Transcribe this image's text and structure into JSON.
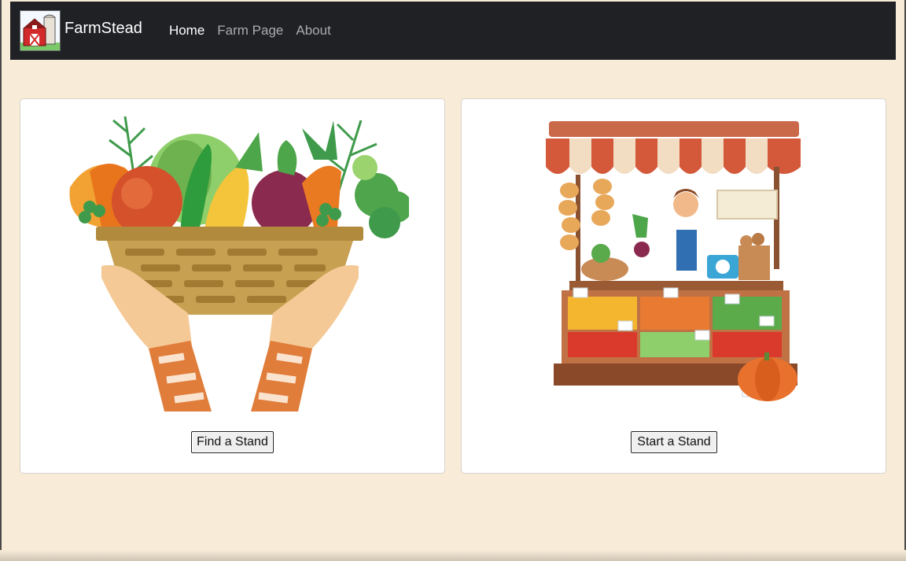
{
  "navbar": {
    "brand": "FarmStead",
    "links": [
      {
        "label": "Home",
        "active": true
      },
      {
        "label": "Farm Page",
        "active": false
      },
      {
        "label": "About",
        "active": false
      }
    ]
  },
  "cards": [
    {
      "button_label": "Find a Stand"
    },
    {
      "button_label": "Start a Stand"
    }
  ],
  "colors": {
    "background": "#f8ebd8",
    "navbar": "#1f2125"
  }
}
